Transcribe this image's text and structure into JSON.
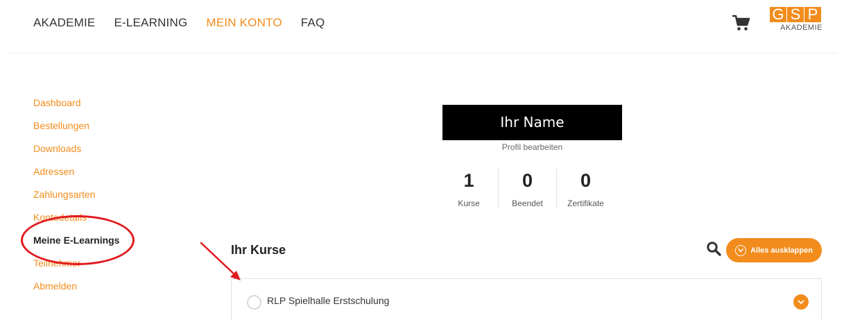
{
  "header": {
    "nav": [
      "AKADEMIE",
      "E-LEARNING",
      "MEIN KONTO",
      "FAQ"
    ],
    "active_nav": "MEIN KONTO",
    "logo": {
      "letters": [
        "G",
        "S",
        "P"
      ],
      "subtitle": "AKADEMIE"
    },
    "cart_icon": "cart-icon"
  },
  "sidebar": {
    "items": [
      "Dashboard",
      "Bestellungen",
      "Downloads",
      "Adressen",
      "Zahlungsarten",
      "Kontodetails",
      "Meine E-Learnings",
      "Teilnehmer",
      "Abmelden"
    ],
    "current": "Meine E-Learnings"
  },
  "profile": {
    "name": "Ihr Name",
    "edit_link": "Profil bearbeiten",
    "stats": [
      {
        "value": "1",
        "label": "Kurse"
      },
      {
        "value": "0",
        "label": "Beendet"
      },
      {
        "value": "0",
        "label": "Zertifikate"
      }
    ]
  },
  "courses": {
    "title": "Ihr Kurse",
    "expand_all": "Alles ausklappen",
    "items": [
      {
        "name": "RLP Spielhalle Erstschulung"
      }
    ]
  },
  "colors": {
    "accent": "#f28c1c",
    "annotation": "#e0191f"
  }
}
